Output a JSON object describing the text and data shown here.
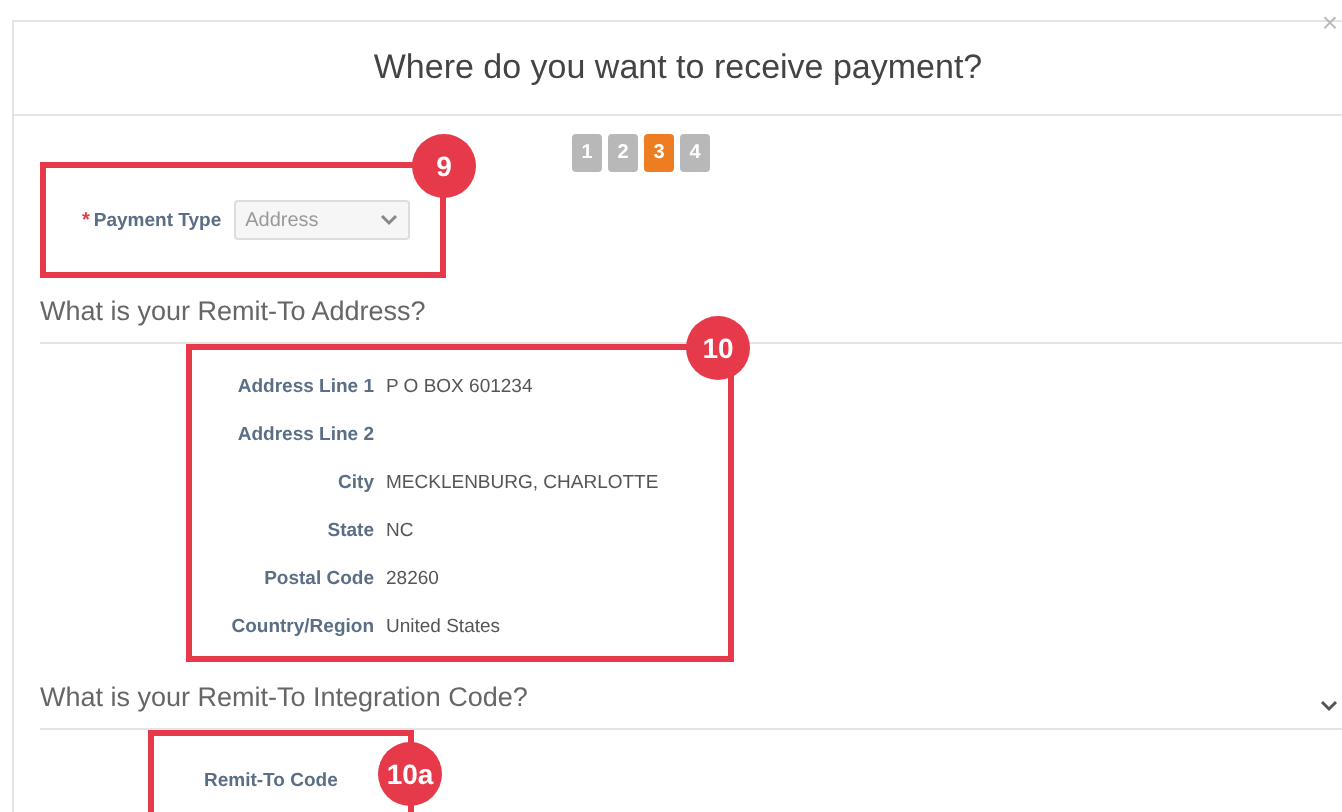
{
  "dialog": {
    "title": "Where do you want to receive payment?",
    "close": "×"
  },
  "steps": [
    {
      "label": "1",
      "selected": false
    },
    {
      "label": "2",
      "selected": false
    },
    {
      "label": "3",
      "selected": true
    },
    {
      "label": "4",
      "selected": false
    }
  ],
  "payment_type": {
    "label": "Payment Type",
    "required_mark": "*",
    "value": "Address",
    "disabled": true,
    "callout": "9"
  },
  "remit_address": {
    "heading": "What is your Remit-To Address?",
    "callout": "10",
    "fields": [
      {
        "label": "Address Line 1",
        "value": "P O BOX 601234"
      },
      {
        "label": "Address Line 2"
      },
      {
        "label": "City",
        "value": "MECKLENBURG, CHARLOTTE"
      },
      {
        "label": "State",
        "value": "NC"
      },
      {
        "label": "Postal Code",
        "value": "28260"
      },
      {
        "label": "Country/Region",
        "value": "United States"
      }
    ]
  },
  "integration": {
    "heading": "What is your Remit-To Integration Code?",
    "expanded": true,
    "callout": "10a",
    "fields": [
      {
        "label": "Remit-To Code"
      }
    ]
  }
}
